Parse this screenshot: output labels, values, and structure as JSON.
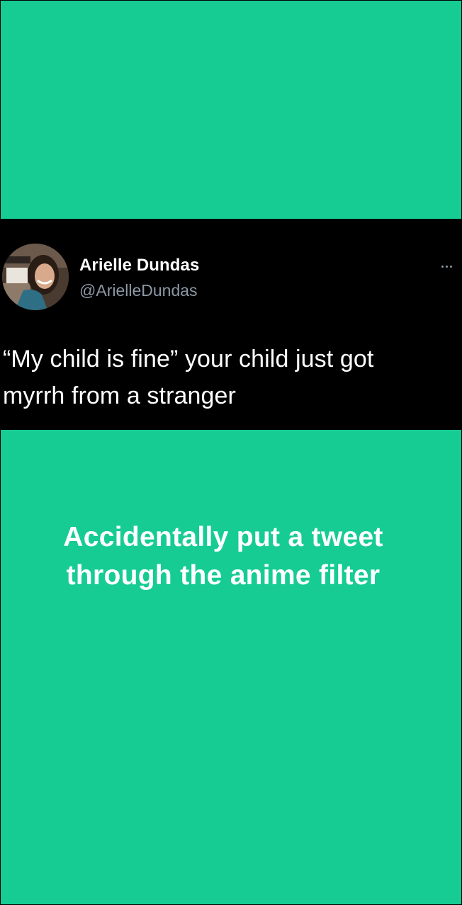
{
  "colors": {
    "background": "#16CC93",
    "tweet_card": "#000000",
    "name_text": "#FFFFFF",
    "handle_text": "#8B98A5"
  },
  "tweet": {
    "author_name": "Arielle Dundas",
    "author_handle": "@ArielleDundas",
    "text_line1": "“My child is fine” your child just got",
    "text_line2": "myrrh from a stranger",
    "more_icon": "ellipsis-icon"
  },
  "caption": {
    "line1": "Accidentally put a tweet",
    "line2": "through the anime filter"
  }
}
